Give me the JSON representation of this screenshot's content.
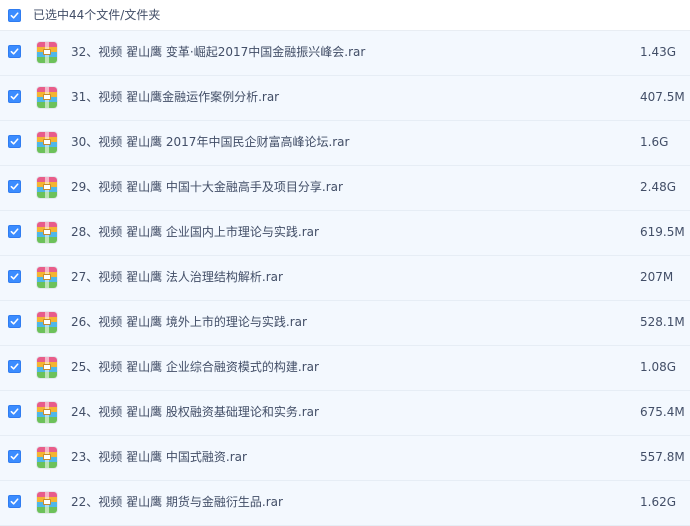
{
  "header": {
    "select_all_checked": true,
    "selection_text": "已选中44个文件/文件夹"
  },
  "files": [
    {
      "checked": true,
      "icon": "rar-archive-icon",
      "name": "32、视频 翟山鹰 变革·崛起2017中国金融振兴峰会.rar",
      "size": "1.43G"
    },
    {
      "checked": true,
      "icon": "rar-archive-icon",
      "name": "31、视频 翟山鹰金融运作案例分析.rar",
      "size": "407.5M"
    },
    {
      "checked": true,
      "icon": "rar-archive-icon",
      "name": "30、视频 翟山鹰 2017年中国民企财富高峰论坛.rar",
      "size": "1.6G"
    },
    {
      "checked": true,
      "icon": "rar-archive-icon",
      "name": "29、视频 翟山鹰 中国十大金融高手及项目分享.rar",
      "size": "2.48G"
    },
    {
      "checked": true,
      "icon": "rar-archive-icon",
      "name": "28、视频 翟山鹰 企业国内上市理论与实践.rar",
      "size": "619.5M"
    },
    {
      "checked": true,
      "icon": "rar-archive-icon",
      "name": "27、视频 翟山鹰 法人治理结构解析.rar",
      "size": "207M"
    },
    {
      "checked": true,
      "icon": "rar-archive-icon",
      "name": "26、视频 翟山鹰 境外上市的理论与实践.rar",
      "size": "528.1M"
    },
    {
      "checked": true,
      "icon": "rar-archive-icon",
      "name": "25、视频 翟山鹰 企业综合融资模式的构建.rar",
      "size": "1.08G"
    },
    {
      "checked": true,
      "icon": "rar-archive-icon",
      "name": "24、视频 翟山鹰 股权融资基础理论和实务.rar",
      "size": "675.4M"
    },
    {
      "checked": true,
      "icon": "rar-archive-icon",
      "name": "23、视频 翟山鹰 中国式融资.rar",
      "size": "557.8M"
    },
    {
      "checked": true,
      "icon": "rar-archive-icon",
      "name": "22、视频 翟山鹰 期货与金融衍生品.rar",
      "size": "1.62G"
    }
  ],
  "colors": {
    "checkbox": "#3b8cff",
    "row_background": "#f3f8fe",
    "text": "#424e67"
  }
}
